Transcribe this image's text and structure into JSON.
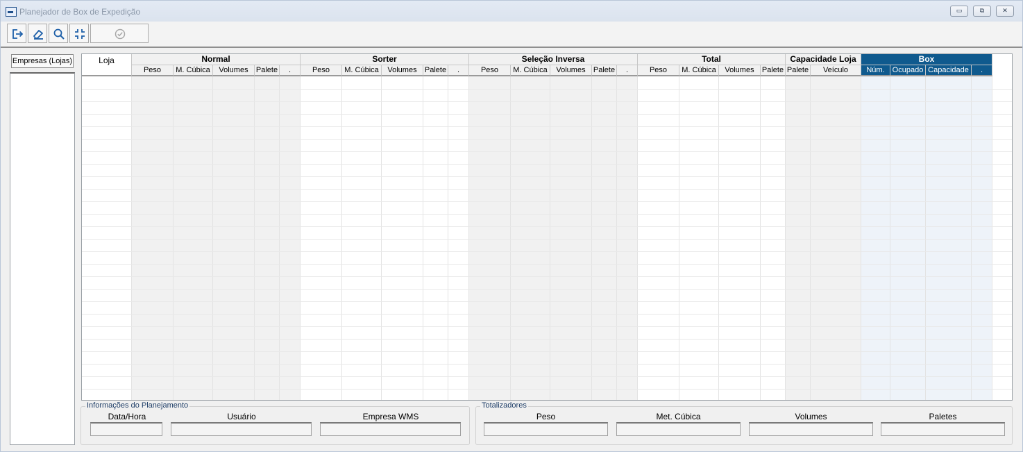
{
  "window": {
    "title": "Planejador de Box de Expedição",
    "minimize_icon": "minimize-icon",
    "maximize_icon": "restore-icon",
    "close_icon": "close-icon"
  },
  "toolbar": {
    "buttons": [
      {
        "icon": "exit-icon"
      },
      {
        "icon": "eraser-icon"
      },
      {
        "icon": "search-icon"
      },
      {
        "icon": "collapse-icon"
      },
      {
        "icon": "check-circle-icon"
      }
    ]
  },
  "left_panel": {
    "tab_label": "Empresas (Lojas)"
  },
  "grid": {
    "loja_header": "Loja",
    "groups": [
      {
        "label": "Normal",
        "columns": [
          "Peso",
          "M. Cúbica",
          "Volumes",
          "Palete",
          "."
        ]
      },
      {
        "label": "Sorter",
        "columns": [
          "Peso",
          "M. Cúbica",
          "Volumes",
          "Palete",
          "."
        ]
      },
      {
        "label": "Seleção Inversa",
        "columns": [
          "Peso",
          "M. Cúbica",
          "Volumes",
          "Palete",
          "."
        ]
      },
      {
        "label": "Total",
        "columns": [
          "Peso",
          "M. Cúbica",
          "Volumes",
          "Palete"
        ]
      },
      {
        "label": "Capacidade Loja",
        "columns": [
          "Palete",
          "Veículo"
        ]
      },
      {
        "label": "Box",
        "columns": [
          "Núm.",
          "Ocupado",
          "Capacidade",
          "."
        ]
      }
    ],
    "accent_color": "#0f5a8e",
    "shaded_color": "#f1f1f1",
    "box_shaded_color": "#eef3f9"
  },
  "planning_info": {
    "title": "Informações do Planejamento",
    "fields": [
      "Data/Hora",
      "Usuário",
      "Empresa WMS"
    ]
  },
  "totals": {
    "title": "Totalizadores",
    "fields": [
      "Peso",
      "Met. Cúbica",
      "Volumes",
      "Paletes"
    ]
  }
}
